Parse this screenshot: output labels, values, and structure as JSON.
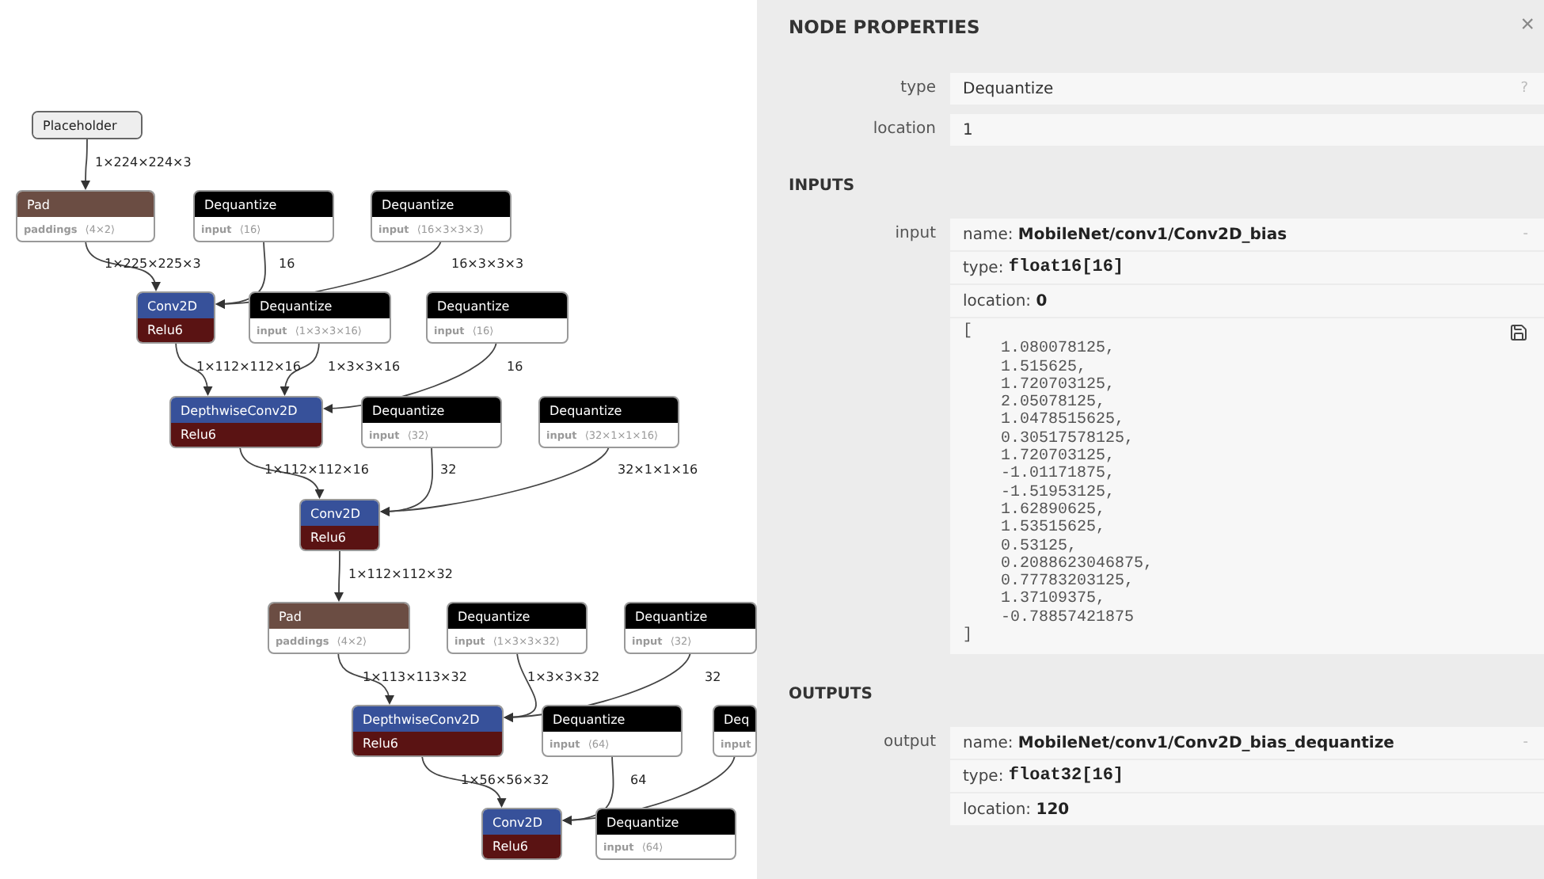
{
  "graph": {
    "nodes": [
      {
        "kind": "placeholder",
        "title": "Placeholder"
      },
      {
        "kind": "shape",
        "title": "Pad",
        "attribute": "**paddings** ⟨4×2⟩"
      },
      {
        "kind": "quantization",
        "title": "Dequantize",
        "attribute": "**input** ⟨16⟩"
      },
      {
        "kind": "quantization",
        "title": "Dequantize",
        "attribute": "**input** ⟨16×3×3×3⟩"
      },
      {
        "kind": "layer",
        "title": "Conv2D",
        "activation": "Relu6"
      },
      {
        "kind": "quantization",
        "title": "Dequantize",
        "attribute": "**input** ⟨1×3×3×16⟩"
      },
      {
        "kind": "quantization",
        "title": "Dequantize",
        "attribute": "**input** ⟨16⟩"
      },
      {
        "kind": "layer",
        "title": "DepthwiseConv2D",
        "activation": "Relu6"
      },
      {
        "kind": "quantization",
        "title": "Dequantize",
        "attribute": "**input** ⟨32⟩"
      },
      {
        "kind": "quantization",
        "title": "Dequantize",
        "attribute": "**input** ⟨32×1×1×16⟩"
      },
      {
        "kind": "layer",
        "title": "Conv2D",
        "activation": "Relu6"
      },
      {
        "kind": "shape",
        "title": "Pad",
        "attribute": "**paddings** ⟨4×2⟩"
      },
      {
        "kind": "quantization",
        "title": "Dequantize",
        "attribute": "**input** ⟨1×3×3×32⟩"
      },
      {
        "kind": "quantization",
        "title": "Dequantize",
        "attribute": "**input** ⟨32⟩"
      },
      {
        "kind": "layer",
        "title": "DepthwiseConv2D",
        "activation": "Relu6"
      },
      {
        "kind": "quantization",
        "title": "Dequantize",
        "attribute": "**input** ⟨64⟩"
      },
      {
        "kind": "quantization",
        "title": "Deq",
        "attribute": "**input**"
      },
      {
        "kind": "layer",
        "title": "Conv2D",
        "activation": "Relu6"
      },
      {
        "kind": "quantization",
        "title": "Dequantize",
        "attribute": "**input** ⟨64⟩"
      }
    ],
    "edges": [
      {
        "label": "1×224×224×3"
      },
      {
        "label": "1×225×225×3"
      },
      {
        "label": "16"
      },
      {
        "label": "16×3×3×3"
      },
      {
        "label": "1×112×112×16"
      },
      {
        "label": "1×3×3×16"
      },
      {
        "label": "16"
      },
      {
        "label": "1×112×112×16"
      },
      {
        "label": "32"
      },
      {
        "label": "32×1×1×16"
      },
      {
        "label": "1×112×112×32"
      },
      {
        "label": "1×113×113×32"
      },
      {
        "label": "1×3×3×32"
      },
      {
        "label": "32"
      },
      {
        "label": "1×56×56×32"
      },
      {
        "label": "64"
      }
    ]
  },
  "panel": {
    "title": "NODE PROPERTIES",
    "close": "×",
    "properties": [
      {
        "label": "type",
        "value": "Dequantize",
        "hint": "?"
      },
      {
        "label": "location",
        "value": "1"
      }
    ],
    "sections": [
      {
        "title": "INPUTS",
        "arguments": [
          {
            "label": "input",
            "toggle": "-",
            "fields": [
              {
                "kind": "name",
                "label": "name:",
                "value": "MobileNet/conv1/Conv2D_bias"
              },
              {
                "kind": "type",
                "label": "type:",
                "value": "float16[16]"
              },
              {
                "kind": "location",
                "label": "location:",
                "value": "0"
              },
              {
                "kind": "tensor",
                "value": "[\n    1.080078125,\n    1.515625,\n    1.720703125,\n    2.05078125,\n    1.0478515625,\n    0.30517578125,\n    1.720703125,\n    -1.01171875,\n    -1.51953125,\n    1.62890625,\n    1.53515625,\n    0.53125,\n    0.2088623046875,\n    0.77783203125,\n    1.37109375,\n    -0.78857421875\n]"
              }
            ]
          }
        ]
      },
      {
        "title": "OUTPUTS",
        "arguments": [
          {
            "label": "output",
            "toggle": "-",
            "fields": [
              {
                "kind": "name",
                "label": "name:",
                "value": "MobileNet/conv1/Conv2D_bias_dequantize"
              },
              {
                "kind": "type",
                "label": "type:",
                "value": "float32[16]"
              },
              {
                "kind": "location",
                "label": "location:",
                "value": "120"
              }
            ]
          }
        ]
      }
    ]
  }
}
